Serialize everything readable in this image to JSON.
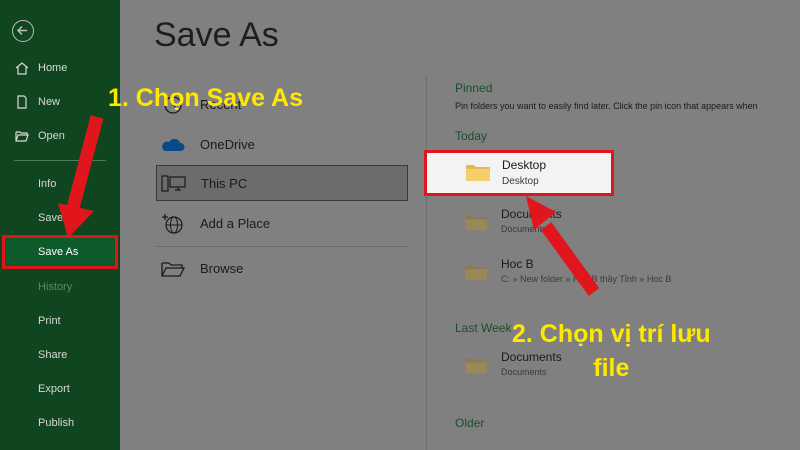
{
  "sidebar": {
    "items": [
      {
        "label": "Home",
        "icon": "home-icon"
      },
      {
        "label": "New",
        "icon": "new-document-icon"
      },
      {
        "label": "Open",
        "icon": "folder-open-icon"
      },
      {
        "label": "Info"
      },
      {
        "label": "Save"
      },
      {
        "label": "Save As",
        "selected": true
      },
      {
        "label": "History",
        "disabled": true
      },
      {
        "label": "Print"
      },
      {
        "label": "Share"
      },
      {
        "label": "Export"
      },
      {
        "label": "Publish"
      }
    ]
  },
  "main": {
    "title": "Save As",
    "locations": [
      {
        "label": "Recent",
        "icon": "clock-icon"
      },
      {
        "label": "OneDrive",
        "icon": "cloud-icon"
      },
      {
        "label": "This PC",
        "icon": "computer-icon",
        "selected": true
      },
      {
        "label": "Add a Place",
        "icon": "globe-icon"
      },
      {
        "label": "Browse",
        "icon": "folder-icon"
      }
    ],
    "pinned": {
      "heading": "Pinned",
      "description": "Pin folders you want to easily find later. Click the pin icon that appears when"
    },
    "today": {
      "heading": "Today",
      "folders": [
        {
          "name": "Desktop",
          "path": "Desktop",
          "highlighted": true
        },
        {
          "name": "Documents",
          "path": "Documents"
        },
        {
          "name": "Hoc B",
          "path": "C: » New folder » Hoc B thầy Tỉnh » Hoc B"
        }
      ]
    },
    "last_week": {
      "heading": "Last Week",
      "folders": [
        {
          "name": "Documents",
          "path": "Documents"
        }
      ]
    },
    "older": {
      "heading": "Older"
    }
  },
  "annotations": {
    "step1": "1. Chọn Save As",
    "step2_line1": "2. Chọn vị trí lưu",
    "step2_line2": "file",
    "color": "#ffe800",
    "arrow_color": "#e0161c"
  },
  "colors": {
    "sidebar_bg": "#10461f",
    "accent_green": "#1c4d2c",
    "highlight_red": "#e0161c"
  }
}
